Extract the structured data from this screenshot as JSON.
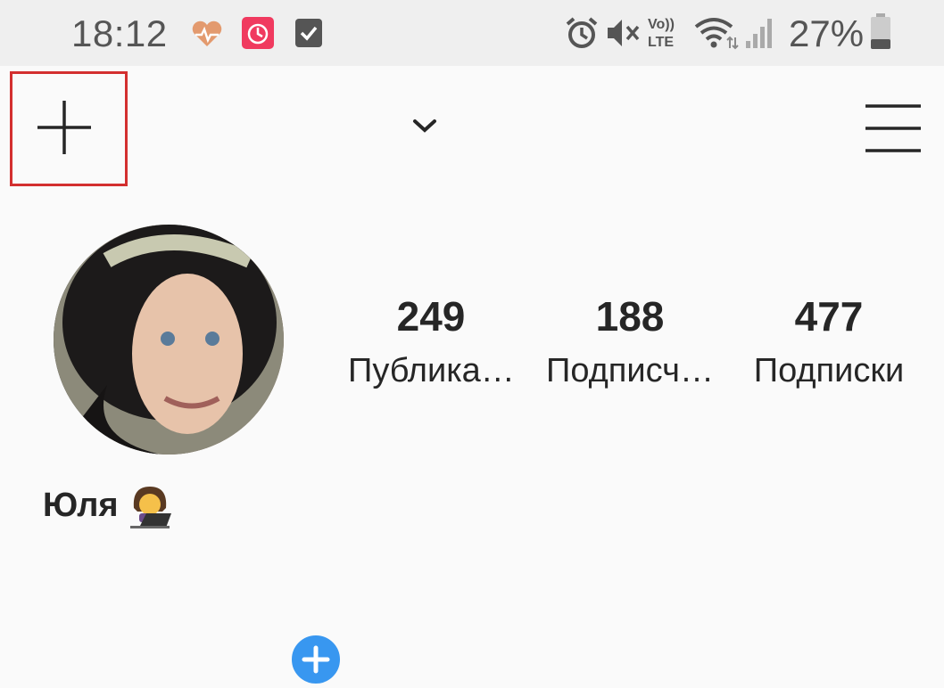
{
  "status_bar": {
    "time": "18:12",
    "battery_percent": "27%",
    "icons": [
      "heart-health-icon",
      "calendar-app-icon",
      "checkbox-app-icon",
      "alarm-icon",
      "mute-icon",
      "volte-icon",
      "wifi-icon",
      "signal-icon",
      "battery-icon"
    ]
  },
  "toolbar": {
    "add_icon": "plus-icon",
    "dropdown_icon": "chevron-down-icon",
    "menu_icon": "hamburger-menu-icon"
  },
  "profile": {
    "name": "Юля",
    "stats": [
      {
        "value": "249",
        "label": "Публика…"
      },
      {
        "value": "188",
        "label": "Подписч…"
      },
      {
        "value": "477",
        "label": "Подписки"
      }
    ]
  },
  "colors": {
    "accent": "#3897f0",
    "highlight": "#d32f2f",
    "text": "#262626"
  }
}
